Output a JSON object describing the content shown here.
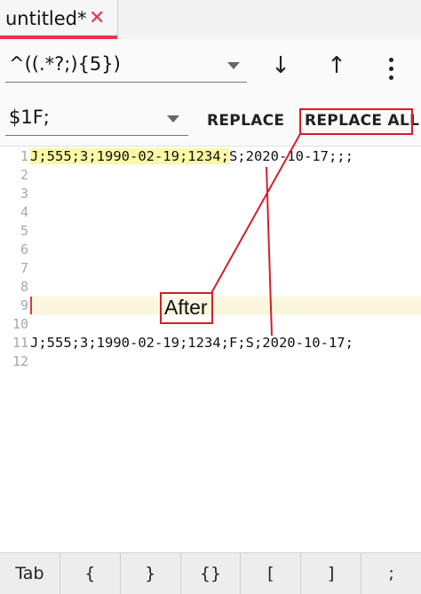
{
  "tab": {
    "title": "untitled*",
    "close_glyph": "✕"
  },
  "find": {
    "value": "^((.*?;){5})"
  },
  "nav": {
    "down": "↓",
    "up": "↑"
  },
  "replace": {
    "value": "$1F;",
    "replace_label": "REPLACE",
    "replace_all_label": "REPLACE ALL"
  },
  "editor": {
    "line_numbers": [
      "1",
      "2",
      "3",
      "4",
      "5",
      "6",
      "7",
      "8",
      "9",
      "10",
      "11",
      "12"
    ],
    "line1_match": "J;555;3;1990-02-19;1234;",
    "line1_rest": "S;2020-10-17;;;",
    "line11": "J;555;3;1990-02-19;1234;F;S;2020-10-17;"
  },
  "annotation": {
    "label": "After"
  },
  "keys": [
    "Tab",
    "{",
    "}",
    "{}",
    "[",
    "]",
    ";"
  ],
  "colors": {
    "accent": "#e8334a",
    "annotation": "#d21f2c",
    "match_highlight": "#fbf8a6"
  }
}
